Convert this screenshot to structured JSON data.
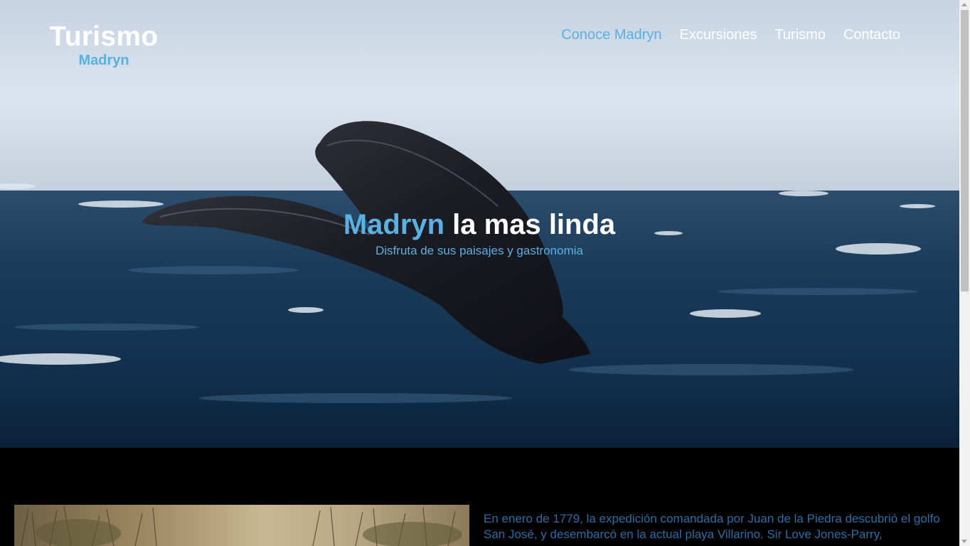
{
  "header": {
    "logo_title": "Turismo",
    "logo_subtitle": "Madryn"
  },
  "nav": {
    "items": [
      {
        "label": "Conoce Madryn",
        "active": true
      },
      {
        "label": "Excursiones",
        "active": false
      },
      {
        "label": "Turismo",
        "active": false
      },
      {
        "label": "Contacto",
        "active": false
      }
    ]
  },
  "hero": {
    "title_accent": "Madryn",
    "title_rest": " la mas linda",
    "subtitle": "Disfruta de sus paisajes y gastronomia"
  },
  "content": {
    "paragraph": "En enero de 1779, la expedición comandada por Juan de la Piedra descubrió el golfo San José, y desembarcó en la actual playa Villarino. Sir Love Jones-Parry,"
  },
  "colors": {
    "accent": "#5ab0e0",
    "text_link": "#2d6ca2",
    "background": "#000000"
  }
}
